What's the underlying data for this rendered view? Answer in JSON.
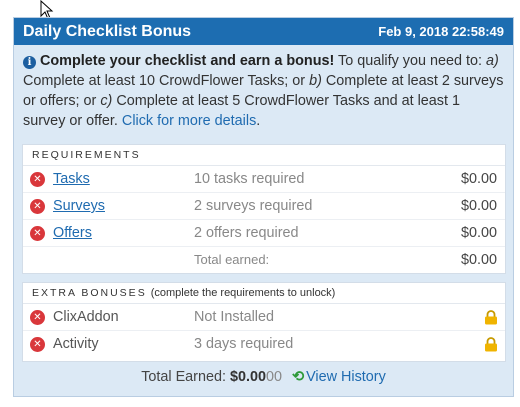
{
  "header": {
    "title": "Daily Checklist Bonus",
    "date": "Feb 9, 2018 22:58:49"
  },
  "intro": {
    "icon": "info-icon",
    "lead": "Complete your checklist and earn a bonus!",
    "text1": " To qualify you need to: ",
    "opt_a": "a)",
    "text2": " Complete at least 10 CrowdFlower Tasks; or ",
    "opt_b": "b)",
    "text3": " Complete at least 2 surveys or offers; or ",
    "opt_c": "c)",
    "text4": " Complete at least 5 CrowdFlower Tasks and at least 1 survey or offer. ",
    "link": "Click for more details",
    "end": "."
  },
  "requirements": {
    "title": "REQUIREMENTS",
    "rows": [
      {
        "name": "Tasks",
        "status": "10 tasks required",
        "amount": "$0.00"
      },
      {
        "name": "Surveys",
        "status": "2 surveys required",
        "amount": "$0.00"
      },
      {
        "name": "Offers",
        "status": "2 offers required",
        "amount": "$0.00"
      }
    ],
    "total_label": "Total earned:",
    "total_amount": "$0.00"
  },
  "extra": {
    "title": "EXTRA BONUSES",
    "note": "(complete the requirements to unlock)",
    "rows": [
      {
        "name": "ClixAddon",
        "status": "Not Installed"
      },
      {
        "name": "Activity",
        "status": "3 days required"
      }
    ]
  },
  "footer": {
    "label": "Total Earned:",
    "amount": "$0.00",
    "cents": "00",
    "history_link": "View History"
  },
  "colors": {
    "header_bg": "#1d6db1",
    "link": "#1f6bb0",
    "error_icon": "#d9373b",
    "lock_icon": "#f0b400",
    "history_icon": "#2e9a3a"
  }
}
